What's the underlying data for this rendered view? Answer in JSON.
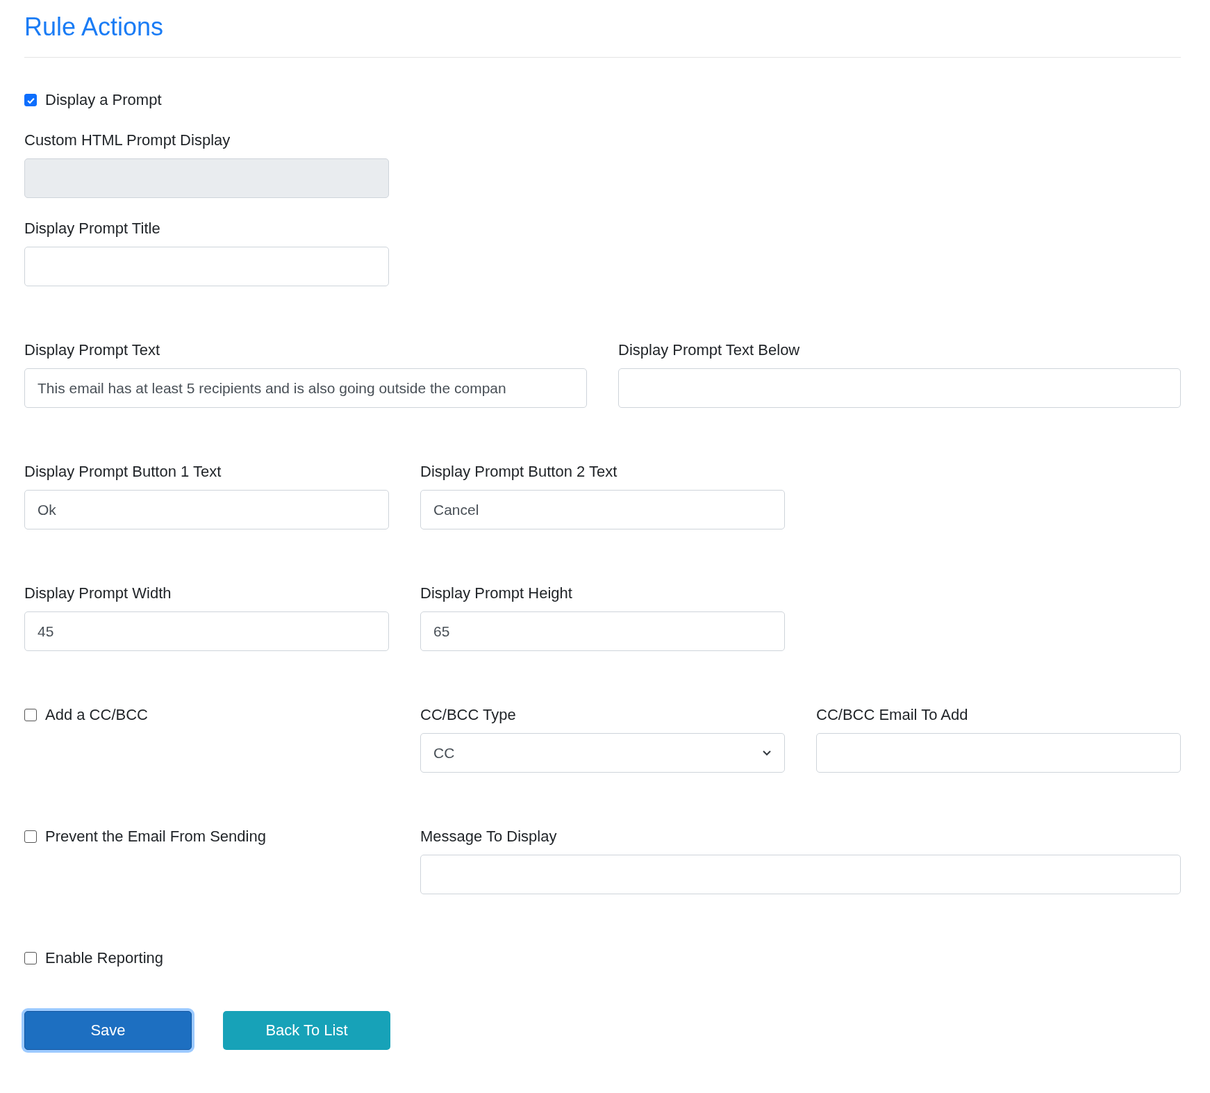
{
  "title": "Rule Actions",
  "display_prompt": {
    "label": "Display a Prompt",
    "checked": true
  },
  "custom_html_prompt": {
    "label": "Custom HTML Prompt Display",
    "disabled": true
  },
  "prompt_title": {
    "label": "Display Prompt Title"
  },
  "prompt_text": {
    "label": "Display Prompt Text",
    "value": "This email has at least 5 recipients and is also going outside the compan"
  },
  "prompt_text_below": {
    "label": "Display Prompt Text Below"
  },
  "button1_text": {
    "label": "Display Prompt Button 1 Text",
    "value": "Ok"
  },
  "button2_text": {
    "label": "Display Prompt Button 2 Text",
    "value": "Cancel"
  },
  "prompt_width": {
    "label": "Display Prompt Width",
    "value": "45"
  },
  "prompt_height": {
    "label": "Display Prompt Height",
    "value": "65"
  },
  "add_cc_bcc": {
    "label": "Add a CC/BCC",
    "checked": false
  },
  "cc_bcc_type": {
    "label": "CC/BCC Type",
    "value": "CC"
  },
  "cc_bcc_email": {
    "label": "CC/BCC Email To Add"
  },
  "prevent_sending": {
    "label": "Prevent the Email From Sending",
    "checked": false
  },
  "message_to_display": {
    "label": "Message To Display"
  },
  "enable_reporting": {
    "label": "Enable Reporting",
    "checked": false
  },
  "buttons": [
    {
      "label": "Save",
      "kind": "primary",
      "focused": true
    },
    {
      "label": "Back To List",
      "kind": "info",
      "focused": false
    }
  ]
}
